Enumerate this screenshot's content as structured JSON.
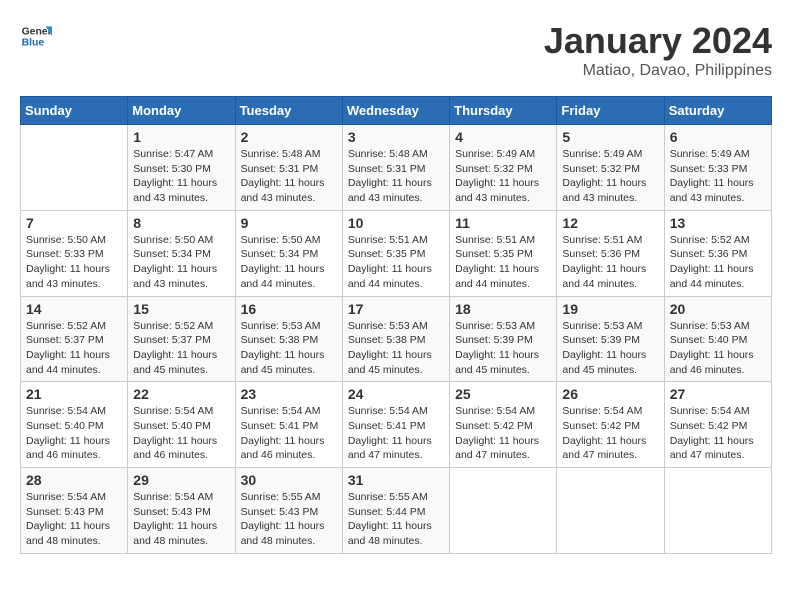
{
  "logo": {
    "line1": "General",
    "line2": "Blue"
  },
  "title": "January 2024",
  "location": "Matiao, Davao, Philippines",
  "headers": [
    "Sunday",
    "Monday",
    "Tuesday",
    "Wednesday",
    "Thursday",
    "Friday",
    "Saturday"
  ],
  "weeks": [
    [
      {
        "day": "",
        "sunrise": "",
        "sunset": "",
        "daylight": ""
      },
      {
        "day": "1",
        "sunrise": "Sunrise: 5:47 AM",
        "sunset": "Sunset: 5:30 PM",
        "daylight": "Daylight: 11 hours and 43 minutes."
      },
      {
        "day": "2",
        "sunrise": "Sunrise: 5:48 AM",
        "sunset": "Sunset: 5:31 PM",
        "daylight": "Daylight: 11 hours and 43 minutes."
      },
      {
        "day": "3",
        "sunrise": "Sunrise: 5:48 AM",
        "sunset": "Sunset: 5:31 PM",
        "daylight": "Daylight: 11 hours and 43 minutes."
      },
      {
        "day": "4",
        "sunrise": "Sunrise: 5:49 AM",
        "sunset": "Sunset: 5:32 PM",
        "daylight": "Daylight: 11 hours and 43 minutes."
      },
      {
        "day": "5",
        "sunrise": "Sunrise: 5:49 AM",
        "sunset": "Sunset: 5:32 PM",
        "daylight": "Daylight: 11 hours and 43 minutes."
      },
      {
        "day": "6",
        "sunrise": "Sunrise: 5:49 AM",
        "sunset": "Sunset: 5:33 PM",
        "daylight": "Daylight: 11 hours and 43 minutes."
      }
    ],
    [
      {
        "day": "7",
        "sunrise": "Sunrise: 5:50 AM",
        "sunset": "Sunset: 5:33 PM",
        "daylight": "Daylight: 11 hours and 43 minutes."
      },
      {
        "day": "8",
        "sunrise": "Sunrise: 5:50 AM",
        "sunset": "Sunset: 5:34 PM",
        "daylight": "Daylight: 11 hours and 43 minutes."
      },
      {
        "day": "9",
        "sunrise": "Sunrise: 5:50 AM",
        "sunset": "Sunset: 5:34 PM",
        "daylight": "Daylight: 11 hours and 44 minutes."
      },
      {
        "day": "10",
        "sunrise": "Sunrise: 5:51 AM",
        "sunset": "Sunset: 5:35 PM",
        "daylight": "Daylight: 11 hours and 44 minutes."
      },
      {
        "day": "11",
        "sunrise": "Sunrise: 5:51 AM",
        "sunset": "Sunset: 5:35 PM",
        "daylight": "Daylight: 11 hours and 44 minutes."
      },
      {
        "day": "12",
        "sunrise": "Sunrise: 5:51 AM",
        "sunset": "Sunset: 5:36 PM",
        "daylight": "Daylight: 11 hours and 44 minutes."
      },
      {
        "day": "13",
        "sunrise": "Sunrise: 5:52 AM",
        "sunset": "Sunset: 5:36 PM",
        "daylight": "Daylight: 11 hours and 44 minutes."
      }
    ],
    [
      {
        "day": "14",
        "sunrise": "Sunrise: 5:52 AM",
        "sunset": "Sunset: 5:37 PM",
        "daylight": "Daylight: 11 hours and 44 minutes."
      },
      {
        "day": "15",
        "sunrise": "Sunrise: 5:52 AM",
        "sunset": "Sunset: 5:37 PM",
        "daylight": "Daylight: 11 hours and 45 minutes."
      },
      {
        "day": "16",
        "sunrise": "Sunrise: 5:53 AM",
        "sunset": "Sunset: 5:38 PM",
        "daylight": "Daylight: 11 hours and 45 minutes."
      },
      {
        "day": "17",
        "sunrise": "Sunrise: 5:53 AM",
        "sunset": "Sunset: 5:38 PM",
        "daylight": "Daylight: 11 hours and 45 minutes."
      },
      {
        "day": "18",
        "sunrise": "Sunrise: 5:53 AM",
        "sunset": "Sunset: 5:39 PM",
        "daylight": "Daylight: 11 hours and 45 minutes."
      },
      {
        "day": "19",
        "sunrise": "Sunrise: 5:53 AM",
        "sunset": "Sunset: 5:39 PM",
        "daylight": "Daylight: 11 hours and 45 minutes."
      },
      {
        "day": "20",
        "sunrise": "Sunrise: 5:53 AM",
        "sunset": "Sunset: 5:40 PM",
        "daylight": "Daylight: 11 hours and 46 minutes."
      }
    ],
    [
      {
        "day": "21",
        "sunrise": "Sunrise: 5:54 AM",
        "sunset": "Sunset: 5:40 PM",
        "daylight": "Daylight: 11 hours and 46 minutes."
      },
      {
        "day": "22",
        "sunrise": "Sunrise: 5:54 AM",
        "sunset": "Sunset: 5:40 PM",
        "daylight": "Daylight: 11 hours and 46 minutes."
      },
      {
        "day": "23",
        "sunrise": "Sunrise: 5:54 AM",
        "sunset": "Sunset: 5:41 PM",
        "daylight": "Daylight: 11 hours and 46 minutes."
      },
      {
        "day": "24",
        "sunrise": "Sunrise: 5:54 AM",
        "sunset": "Sunset: 5:41 PM",
        "daylight": "Daylight: 11 hours and 47 minutes."
      },
      {
        "day": "25",
        "sunrise": "Sunrise: 5:54 AM",
        "sunset": "Sunset: 5:42 PM",
        "daylight": "Daylight: 11 hours and 47 minutes."
      },
      {
        "day": "26",
        "sunrise": "Sunrise: 5:54 AM",
        "sunset": "Sunset: 5:42 PM",
        "daylight": "Daylight: 11 hours and 47 minutes."
      },
      {
        "day": "27",
        "sunrise": "Sunrise: 5:54 AM",
        "sunset": "Sunset: 5:42 PM",
        "daylight": "Daylight: 11 hours and 47 minutes."
      }
    ],
    [
      {
        "day": "28",
        "sunrise": "Sunrise: 5:54 AM",
        "sunset": "Sunset: 5:43 PM",
        "daylight": "Daylight: 11 hours and 48 minutes."
      },
      {
        "day": "29",
        "sunrise": "Sunrise: 5:54 AM",
        "sunset": "Sunset: 5:43 PM",
        "daylight": "Daylight: 11 hours and 48 minutes."
      },
      {
        "day": "30",
        "sunrise": "Sunrise: 5:55 AM",
        "sunset": "Sunset: 5:43 PM",
        "daylight": "Daylight: 11 hours and 48 minutes."
      },
      {
        "day": "31",
        "sunrise": "Sunrise: 5:55 AM",
        "sunset": "Sunset: 5:44 PM",
        "daylight": "Daylight: 11 hours and 48 minutes."
      },
      {
        "day": "",
        "sunrise": "",
        "sunset": "",
        "daylight": ""
      },
      {
        "day": "",
        "sunrise": "",
        "sunset": "",
        "daylight": ""
      },
      {
        "day": "",
        "sunrise": "",
        "sunset": "",
        "daylight": ""
      }
    ]
  ]
}
